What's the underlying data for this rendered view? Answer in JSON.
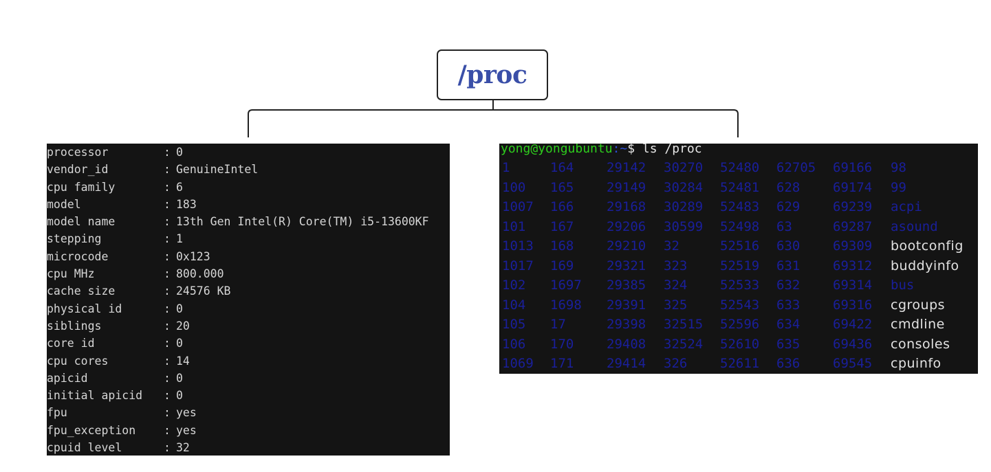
{
  "diagram": {
    "root_label": "/proc",
    "colors": {
      "title": "#3a4fa8",
      "terminal_bg": "#141414",
      "prompt_user": "#2ecc1d",
      "prompt_path": "#2d4fd6",
      "dir_entry": "#1a1f9a"
    }
  },
  "cpuinfo": {
    "lines": [
      {
        "key": "processor",
        "value": "0"
      },
      {
        "key": "vendor_id",
        "value": "GenuineIntel"
      },
      {
        "key": "cpu family",
        "value": "6"
      },
      {
        "key": "model",
        "value": "183"
      },
      {
        "key": "model name",
        "value": "13th Gen Intel(R) Core(TM) i5-13600KF"
      },
      {
        "key": "stepping",
        "value": "1"
      },
      {
        "key": "microcode",
        "value": "0x123"
      },
      {
        "key": "cpu MHz",
        "value": "800.000"
      },
      {
        "key": "cache size",
        "value": "24576 KB"
      },
      {
        "key": "physical id",
        "value": "0"
      },
      {
        "key": "siblings",
        "value": "20"
      },
      {
        "key": "core id",
        "value": "0"
      },
      {
        "key": "cpu cores",
        "value": "14"
      },
      {
        "key": "apicid",
        "value": "0"
      },
      {
        "key": "initial apicid",
        "value": "0"
      },
      {
        "key": "fpu",
        "value": "yes"
      },
      {
        "key": "fpu_exception",
        "value": "yes"
      },
      {
        "key": "cpuid level",
        "value": "32"
      }
    ]
  },
  "ls_terminal": {
    "prompt_user": "yong@yongubuntu",
    "prompt_path": ":~",
    "prompt_cmd": "$ ls /proc",
    "rows": [
      [
        "1",
        "164",
        "29142",
        "30270",
        "52480",
        "62705",
        "69166",
        "98"
      ],
      [
        "100",
        "165",
        "29149",
        "30284",
        "52481",
        "628",
        "69174",
        "99"
      ],
      [
        "1007",
        "166",
        "29168",
        "30289",
        "52483",
        "629",
        "69239",
        "acpi"
      ],
      [
        "101",
        "167",
        "29206",
        "30599",
        "52498",
        "63",
        "69287",
        "asound"
      ],
      [
        "1013",
        "168",
        "29210",
        "32",
        "52516",
        "630",
        "69309",
        "bootconfig"
      ],
      [
        "1017",
        "169",
        "29321",
        "323",
        "52519",
        "631",
        "69312",
        "buddyinfo"
      ],
      [
        "102",
        "1697",
        "29385",
        "324",
        "52533",
        "632",
        "69314",
        "bus"
      ],
      [
        "104",
        "1698",
        "29391",
        "325",
        "52543",
        "633",
        "69316",
        "cgroups"
      ],
      [
        "105",
        "17",
        "29398",
        "32515",
        "52596",
        "634",
        "69422",
        "cmdline"
      ],
      [
        "106",
        "170",
        "29408",
        "32524",
        "52610",
        "635",
        "69436",
        "consoles"
      ],
      [
        "1069",
        "171",
        "29414",
        "326",
        "52611",
        "636",
        "69545",
        "cpuinfo"
      ]
    ],
    "file_entries": [
      "bootconfig",
      "buddyinfo",
      "cgroups",
      "cmdline",
      "consoles",
      "cpuinfo"
    ]
  }
}
